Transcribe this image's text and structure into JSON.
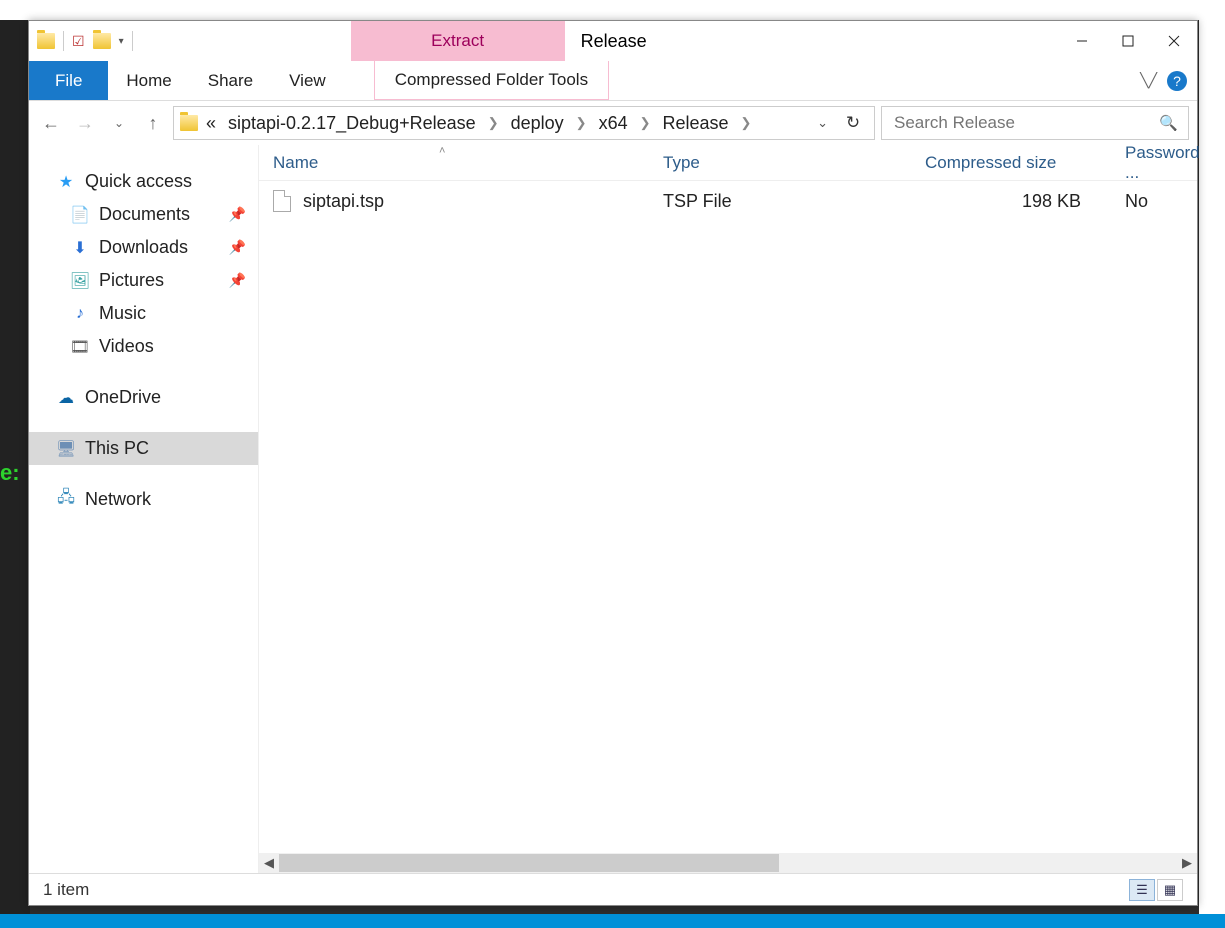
{
  "window": {
    "title": "Release",
    "context_tab": "Extract",
    "context_tools": "Compressed Folder Tools"
  },
  "ribbon": {
    "file": "File",
    "home": "Home",
    "share": "Share",
    "view": "View"
  },
  "breadcrumb": {
    "overflow": "«",
    "items": [
      "siptapi-0.2.17_Debug+Release",
      "deploy",
      "x64",
      "Release"
    ]
  },
  "search": {
    "placeholder": "Search Release"
  },
  "sidebar": {
    "quick_access": "Quick access",
    "documents": "Documents",
    "downloads": "Downloads",
    "pictures": "Pictures",
    "music": "Music",
    "videos": "Videos",
    "onedrive": "OneDrive",
    "this_pc": "This PC",
    "network": "Network"
  },
  "columns": {
    "name": "Name",
    "type": "Type",
    "size": "Compressed size",
    "password": "Password ..."
  },
  "files": [
    {
      "name": "siptapi.tsp",
      "type": "TSP File",
      "size": "198 KB",
      "password": "No"
    }
  ],
  "status": {
    "count": "1 item"
  },
  "bg": {
    "re": "e:"
  }
}
